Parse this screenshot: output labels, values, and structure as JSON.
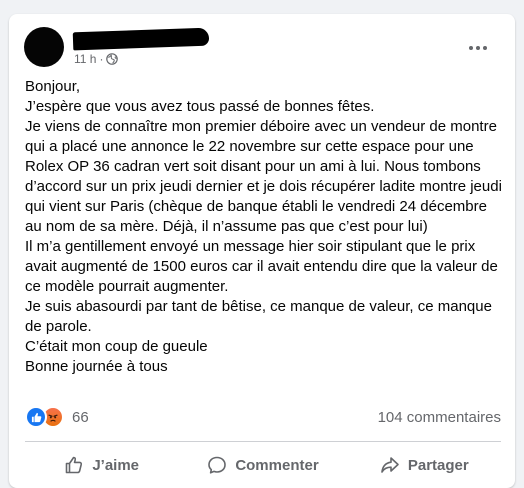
{
  "post": {
    "timestamp": "11 h",
    "separator": "·",
    "privacy_icon": "globe-icon",
    "more_icon": "more-horizontal-icon",
    "paragraphs": [
      "Bonjour,",
      "J’espère que vous avez tous passé de bonnes fêtes.",
      "Je viens de connaître mon premier déboire avec un vendeur de montre qui a placé une annonce le 22 novembre sur cette espace pour une Rolex OP 36 cadran vert soit disant pour un ami à lui. Nous tombons d’accord sur un prix jeudi dernier et je dois récupérer ladite montre jeudi qui vient sur Paris (chèque de banque établi le vendredi 24 décembre au nom de sa mère. Déjà, il n’assume pas que c’est pour lui)",
      "Il m’a gentillement envoyé un message hier soir stipulant que le prix avait augmenté de 1500 euros car il avait entendu dire que la valeur de ce modèle pourrait augmenter.",
      "Je suis abasourdi par tant de bêtise, ce manque de valeur, ce manque de parole.",
      "C’était mon coup de gueule",
      "Bonne journée à tous"
    ]
  },
  "stats": {
    "reactions": [
      "like",
      "angry"
    ],
    "reaction_count": "66",
    "comments": "104 commentaires"
  },
  "actions": {
    "like": "J’aime",
    "comment": "Commenter",
    "share": "Partager"
  },
  "colors": {
    "background": "#f0f2f5",
    "card": "#ffffff",
    "text": "#050505",
    "secondary_text": "#65676b",
    "like_blue": "#1877f2",
    "angry_orange": "#e9710f"
  }
}
